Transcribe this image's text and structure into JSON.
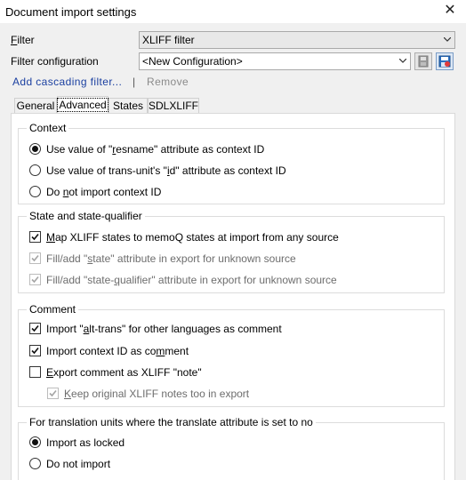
{
  "window": {
    "title": "Document import settings",
    "close_glyph": "✕"
  },
  "filter": {
    "label_pre": "",
    "label_u": "F",
    "label_post": "ilter",
    "value": "XLIFF filter"
  },
  "filter_config": {
    "label": "Filter configuration",
    "value": "<New Configuration>"
  },
  "links": {
    "add_cascading": "Add cascading filter...",
    "separator": "|",
    "remove": "Remove"
  },
  "tabs": [
    {
      "label": "General"
    },
    {
      "label": "Advanced"
    },
    {
      "label": "States"
    },
    {
      "label": "SDLXLIFF"
    }
  ],
  "groups": {
    "context": {
      "title": "Context",
      "options": [
        {
          "pre": "Use value of \"",
          "u": "r",
          "post": "esname\" attribute as context ID",
          "checked": true
        },
        {
          "pre": "Use value of trans-unit's \"",
          "u": "i",
          "post": "d\" attribute as context ID",
          "checked": false
        },
        {
          "pre": "Do ",
          "u": "n",
          "post": "ot import context ID",
          "checked": false
        }
      ]
    },
    "state": {
      "title": "State and state-qualifier",
      "options": [
        {
          "pre": "",
          "u": "M",
          "post": "ap XLIFF states to memoQ states at import from any source",
          "checked": true,
          "disabled": false
        },
        {
          "pre": "Fill/add \"",
          "u": "s",
          "post": "tate\" attribute in export for unknown source",
          "checked": true,
          "disabled": true
        },
        {
          "pre": "Fill/add \"state-",
          "u": "q",
          "post": "ualifier\" attribute in export for unknown source",
          "checked": true,
          "disabled": true
        }
      ]
    },
    "comment": {
      "title": "Comment",
      "options": [
        {
          "pre": "Import \"",
          "u": "a",
          "post": "lt-trans\" for other languages as comment",
          "checked": true,
          "disabled": false
        },
        {
          "pre": "Import context ID as co",
          "u": "m",
          "post": "ment",
          "checked": true,
          "disabled": false
        },
        {
          "pre": "",
          "u": "E",
          "post": "xport comment as XLIFF \"note\"",
          "checked": false,
          "disabled": false
        },
        {
          "pre": "",
          "u": "K",
          "post": "eep original XLIFF notes too in export",
          "checked": true,
          "disabled": true
        }
      ]
    },
    "translate": {
      "title": "For translation units where the translate attribute is set to no",
      "options": [
        {
          "pre": "Import as locked",
          "u": "",
          "post": "",
          "checked": true
        },
        {
          "pre": "Do not import",
          "u": "",
          "post": "",
          "checked": false
        }
      ]
    }
  },
  "icons": {
    "close": "close-icon",
    "dropdown": "chevron-down-icon",
    "save_config": "save-icon",
    "save_as_config": "save-as-icon"
  },
  "colors": {
    "link": "#1a3fa0",
    "panel": "#ffffff",
    "window": "#f0f0f0"
  }
}
